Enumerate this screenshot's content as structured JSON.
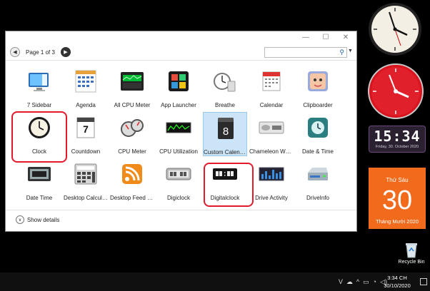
{
  "window": {
    "pager": "Page 1 of 3",
    "show_details": "Show details",
    "minimize": "—",
    "maximize": "☐",
    "close": "✕"
  },
  "gadgets": [
    {
      "label": "7 Sidebar"
    },
    {
      "label": "Agenda"
    },
    {
      "label": "All CPU Meter"
    },
    {
      "label": "App Launcher"
    },
    {
      "label": "Breathe"
    },
    {
      "label": "Calendar"
    },
    {
      "label": "Clipboarder"
    },
    {
      "label": "Clock"
    },
    {
      "label": "Countdown"
    },
    {
      "label": "CPU Meter"
    },
    {
      "label": "CPU Utilization"
    },
    {
      "label": "Custom Calendar"
    },
    {
      "label": "Chameleon Wea..."
    },
    {
      "label": "Date & Time"
    },
    {
      "label": "Date Time"
    },
    {
      "label": "Desktop Calcula..."
    },
    {
      "label": "Desktop Feed R..."
    },
    {
      "label": "Digiclock"
    },
    {
      "label": "Digitalclock"
    },
    {
      "label": "Drive Activity"
    },
    {
      "label": "DriveInfo"
    }
  ],
  "desktop": {
    "digital_clock_time": "15:34",
    "digital_clock_date": "Friday, 30. October 2020",
    "calendar_weekday": "Thứ Sáu",
    "calendar_day": "30",
    "calendar_month": "Tháng Mười 2020",
    "recycle_bin": "Recycle Bin"
  },
  "taskbar": {
    "time": "3:34 CH",
    "date": "30/10/2020"
  },
  "colors": {
    "highlight": "#e21a2c",
    "selected_tile": "#cce4f7",
    "calendar_orange": "#f26a1b",
    "red_clock": "#d9141f"
  }
}
